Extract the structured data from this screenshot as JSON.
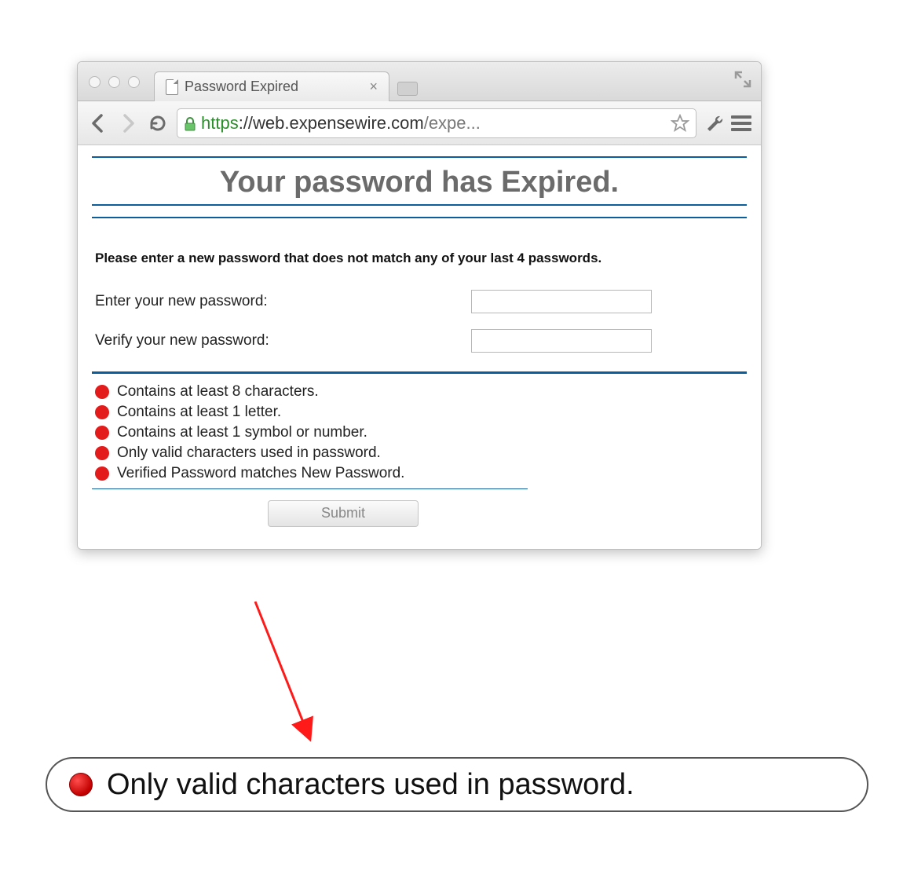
{
  "browser": {
    "tab_title": "Password Expired",
    "url_scheme": "https",
    "url_domain": "://web.expensewire.com",
    "url_path": "/expe..."
  },
  "page": {
    "title": "Your password has Expired.",
    "instruction": "Please enter a new password that does not match any of your last 4 passwords.",
    "labels": {
      "enter": "Enter your new password:",
      "verify": "Verify your new password:"
    },
    "rules": [
      "Contains at least 8 characters.",
      "Contains at least 1 letter.",
      "Contains at least 1 symbol or number.",
      "Only valid characters used in password.",
      "Verified Password matches New Password."
    ],
    "submit_label": "Submit"
  },
  "callout": {
    "text": "Only valid characters used in password."
  }
}
